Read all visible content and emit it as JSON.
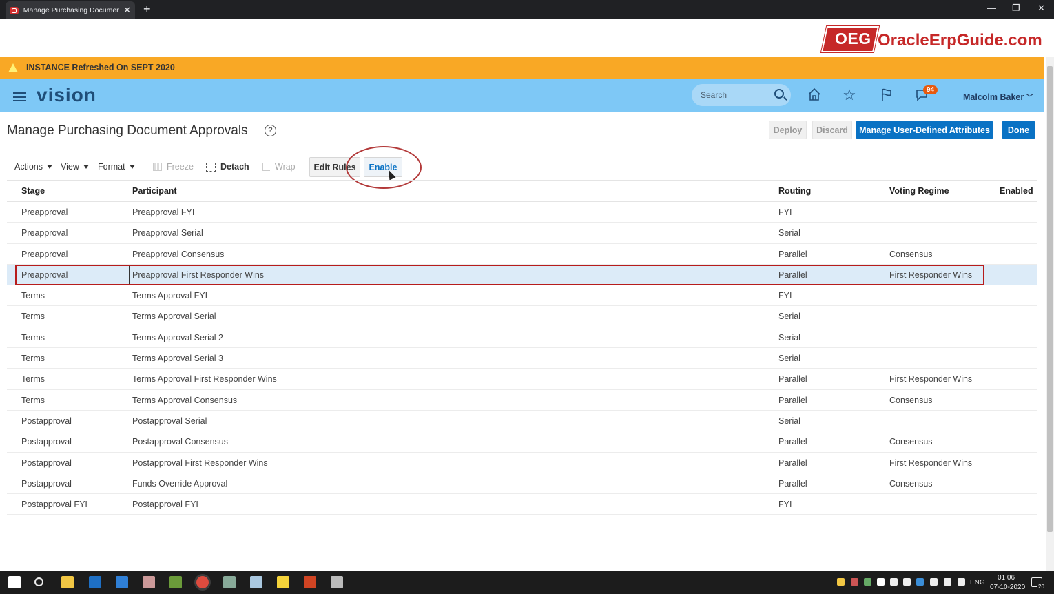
{
  "browser": {
    "tab_title": "Manage Purchasing Document A",
    "close_glyph": "✕",
    "new_tab_glyph": "+",
    "window_controls": [
      "—",
      "❐",
      "✕"
    ]
  },
  "branding": {
    "oeg_logo": "OEG",
    "site_name": "OracleErpGuide.com",
    "brand_color": "#c62828"
  },
  "banner": {
    "text": "INSTANCE Refreshed On SEPT 2020",
    "color": "#f9a825"
  },
  "header": {
    "app_name": "vision",
    "search_placeholder": "Search",
    "notification_count": "94",
    "user_name": "Malcolm Baker",
    "header_color": "#7ec8f6",
    "icons": [
      "menu-icon",
      "search-icon",
      "home-icon",
      "star-icon",
      "flag-icon",
      "notification-icon"
    ]
  },
  "page": {
    "title": "Manage Purchasing Document Approvals",
    "help_glyph": "?",
    "buttons": {
      "deploy": "Deploy",
      "discard": "Discard",
      "manage_attributes": "Manage User-Defined Attributes",
      "done": "Done"
    },
    "accent_color": "#0a72c4"
  },
  "toolbar": {
    "actions": "Actions",
    "view": "View",
    "format": "Format",
    "freeze": "Freeze",
    "detach": "Detach",
    "wrap": "Wrap",
    "edit_rules": "Edit Rules",
    "enable": "Enable"
  },
  "table": {
    "columns": {
      "stage": "Stage",
      "participant": "Participant",
      "routing": "Routing",
      "voting_regime": "Voting Regime",
      "enabled": "Enabled"
    },
    "rows": [
      {
        "stage": "Preapproval",
        "participant": "Preapproval FYI",
        "routing": "FYI",
        "voting": ""
      },
      {
        "stage": "Preapproval",
        "participant": "Preapproval Serial",
        "routing": "Serial",
        "voting": ""
      },
      {
        "stage": "Preapproval",
        "participant": "Preapproval Consensus",
        "routing": "Parallel",
        "voting": "Consensus"
      },
      {
        "stage": "Preapproval",
        "participant": "Preapproval First Responder Wins",
        "routing": "Parallel",
        "voting": "First Responder Wins"
      },
      {
        "stage": "Terms",
        "participant": "Terms Approval FYI",
        "routing": "FYI",
        "voting": ""
      },
      {
        "stage": "Terms",
        "participant": "Terms Approval Serial",
        "routing": "Serial",
        "voting": ""
      },
      {
        "stage": "Terms",
        "participant": "Terms Approval Serial 2",
        "routing": "Serial",
        "voting": ""
      },
      {
        "stage": "Terms",
        "participant": "Terms Approval Serial 3",
        "routing": "Serial",
        "voting": ""
      },
      {
        "stage": "Terms",
        "participant": "Terms Approval First Responder Wins",
        "routing": "Parallel",
        "voting": "First Responder Wins"
      },
      {
        "stage": "Terms",
        "participant": "Terms Approval Consensus",
        "routing": "Parallel",
        "voting": "Consensus"
      },
      {
        "stage": "Postapproval",
        "participant": "Postapproval Serial",
        "routing": "Serial",
        "voting": ""
      },
      {
        "stage": "Postapproval",
        "participant": "Postapproval Consensus",
        "routing": "Parallel",
        "voting": "Consensus"
      },
      {
        "stage": "Postapproval",
        "participant": "Postapproval First Responder Wins",
        "routing": "Parallel",
        "voting": "First Responder Wins"
      },
      {
        "stage": "Postapproval",
        "participant": "Funds Override Approval",
        "routing": "Parallel",
        "voting": "Consensus"
      },
      {
        "stage": "Postapproval FYI",
        "participant": "Postapproval FYI",
        "routing": "FYI",
        "voting": ""
      }
    ],
    "selected_row": 3,
    "selection_color": "#dcebf8",
    "highlight_color": "#b71c1c"
  },
  "taskbar": {
    "language": "ENG",
    "time": "01:06",
    "date": "07-10-2020",
    "notification_count": "20",
    "icons": [
      "windows-start-icon",
      "search-icon",
      "file-explorer-icon",
      "outlook-icon",
      "mail-icon",
      "app-icon",
      "notepad-icon",
      "chrome-icon",
      "app-icon",
      "app-icon",
      "sticky-notes-icon",
      "powerpoint-icon",
      "clock-app-icon"
    ]
  }
}
